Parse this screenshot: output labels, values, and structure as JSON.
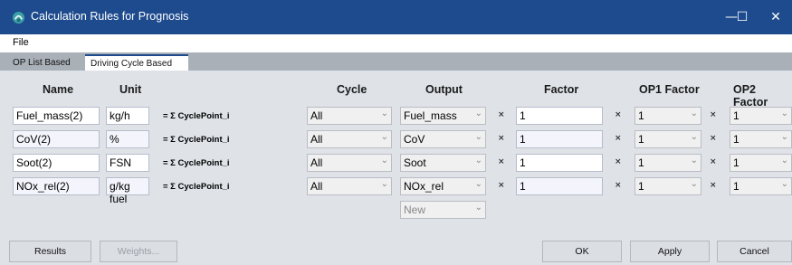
{
  "window": {
    "title": "Calculation Rules for Prognosis",
    "icon": "app-icon",
    "controls": {
      "minimize": "—",
      "maximize": "☐",
      "close": "✕"
    }
  },
  "menu": {
    "file": "File"
  },
  "tabs": [
    "OP List Based",
    "Driving Cycle Based"
  ],
  "headers": {
    "name": "Name",
    "unit": "Unit",
    "cycle": "Cycle",
    "output": "Output",
    "factor": "Factor",
    "op1": "OP1 Factor",
    "op2": "OP2 Factor"
  },
  "sum_label": "= Σ CyclePoint_i",
  "times_symbol": "×",
  "rows": [
    {
      "name": "Fuel_mass(2)",
      "unit": "kg/h",
      "cycle": "All",
      "output": "Fuel_mass",
      "factor": "1",
      "op1": "1",
      "op2": "1"
    },
    {
      "name": "CoV(2)",
      "unit": "%",
      "cycle": "All",
      "output": "CoV",
      "factor": "1",
      "op1": "1",
      "op2": "1"
    },
    {
      "name": "Soot(2)",
      "unit": "FSN",
      "cycle": "All",
      "output": "Soot",
      "factor": "1",
      "op1": "1",
      "op2": "1"
    },
    {
      "name": "NOx_rel(2)",
      "unit": "g/kg fuel",
      "cycle": "All",
      "output": "NOx_rel",
      "factor": "1",
      "op1": "1",
      "op2": "1"
    }
  ],
  "new_output_placeholder": "New",
  "buttons": {
    "results": "Results",
    "weights": "Weights...",
    "ok": "OK",
    "apply": "Apply",
    "cancel": "Cancel"
  },
  "colors": {
    "titlebar": "#1d4b8d",
    "background": "#dfe3e8",
    "tabbar": "#a9b0b8"
  }
}
